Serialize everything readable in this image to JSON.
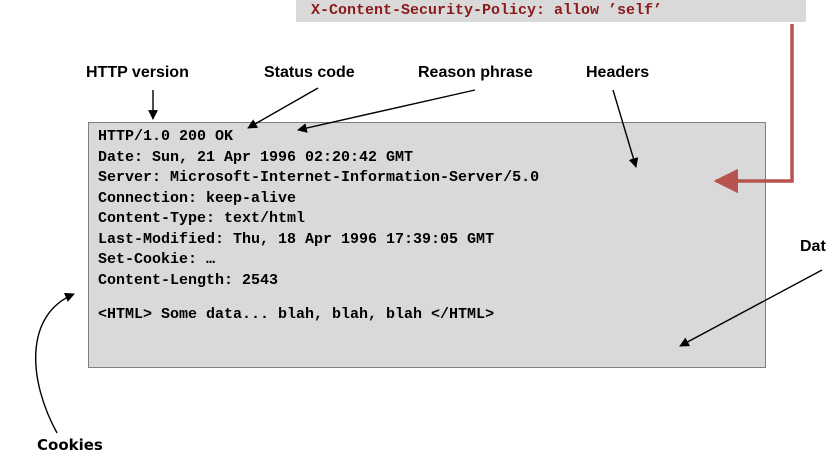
{
  "slide": {
    "title_fragment": "",
    "csp_header": "X-Content-Security-Policy: allow ’self’"
  },
  "labels": {
    "http_version": "HTTP version",
    "status_code": "Status code",
    "reason_phrase": "Reason phrase",
    "headers": "Headers",
    "data": "Dat",
    "cookies": "Cookies"
  },
  "response": {
    "status_line": "HTTP/1.0 200 OK",
    "date": "Date: Sun, 21 Apr 1996 02:20:42 GMT",
    "server": "Server: Microsoft-Internet-Information-Server/5.0",
    "connection": "Connection: keep-alive",
    "content_type": "Content-Type: text/html",
    "last_modified": "Last-Modified: Thu, 18 Apr 1996 17:39:05 GMT",
    "set_cookie": "Set-Cookie: …",
    "content_length": "Content-Length: 2543",
    "body": "<HTML> Some data... blah, blah, blah </HTML>"
  },
  "colors": {
    "csp_text": "#8b1a1a",
    "injection_arrow": "#b85450",
    "box_fill": "#d9d9d9"
  }
}
